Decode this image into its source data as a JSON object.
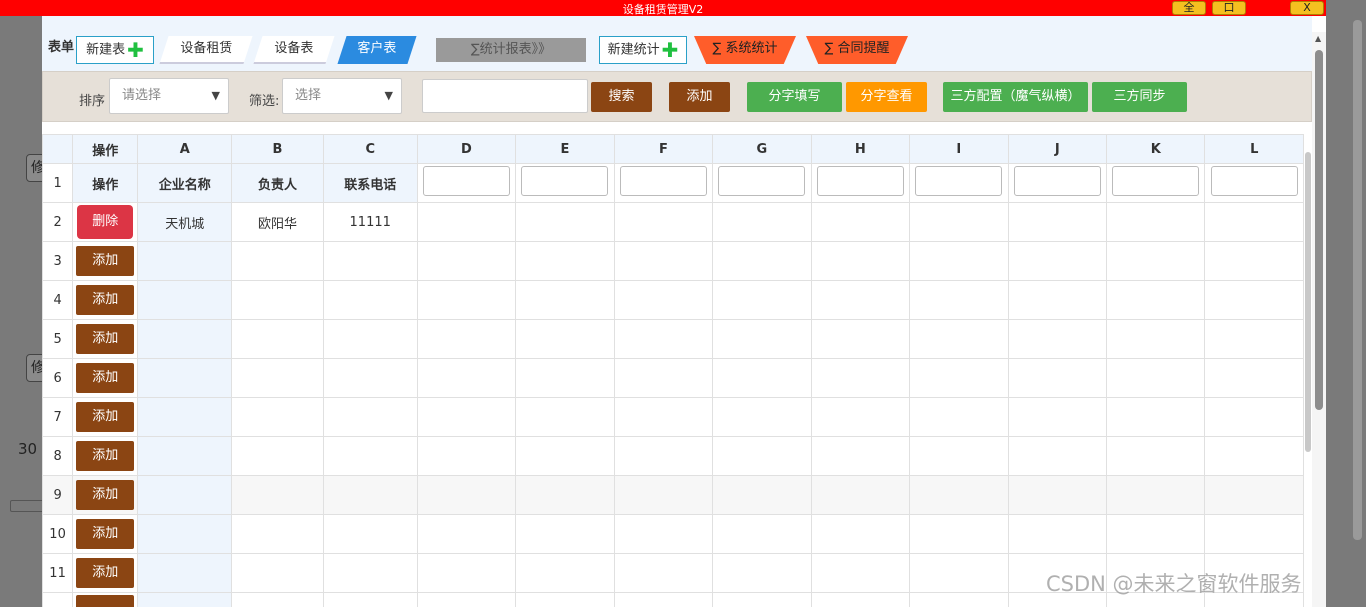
{
  "window": {
    "title": "设备租赁管理V2",
    "btn_full": "全",
    "btn_max": "口",
    "btn_close": "X"
  },
  "background": {
    "button1": "修",
    "button2": "修",
    "number": "30"
  },
  "tabs": {
    "label": "表单",
    "new_table": "新建表",
    "items": [
      "设备租赁",
      "设备表",
      "客户表"
    ],
    "stats_report": "∑统计报表》》",
    "new_stats": "新建统计",
    "sys_stats": "∑ 系统统计",
    "contract_remind": "∑ 合同提醒"
  },
  "toolbar": {
    "sort_label": "排序",
    "sort_placeholder": "请选择",
    "filter_label": "筛选:",
    "filter_placeholder": "选择",
    "search_value": "",
    "search_btn": "搜索",
    "add_btn": "添加",
    "share_fill": "分字填写",
    "share_view": "分字查看",
    "tri_config": "三方配置（魔气纵横）",
    "tri_sync": "三方同步"
  },
  "grid": {
    "corner": "",
    "columns": [
      "操作",
      "A",
      "B",
      "C",
      "D",
      "E",
      "F",
      "G",
      "H",
      "I",
      "J",
      "K",
      "L"
    ],
    "row1": {
      "num": "1",
      "op": "操作",
      "A": "企业名称",
      "B": "负责人",
      "C": "联系电话"
    },
    "row2": {
      "num": "2",
      "op": "删除",
      "A": "天机城",
      "B": "欧阳华",
      "C": "11111"
    },
    "add_label": "添加",
    "add_rows": [
      "3",
      "4",
      "5",
      "6",
      "7",
      "8",
      "9",
      "10",
      "11"
    ]
  },
  "watermark": "CSDN @未来之窗软件服务"
}
